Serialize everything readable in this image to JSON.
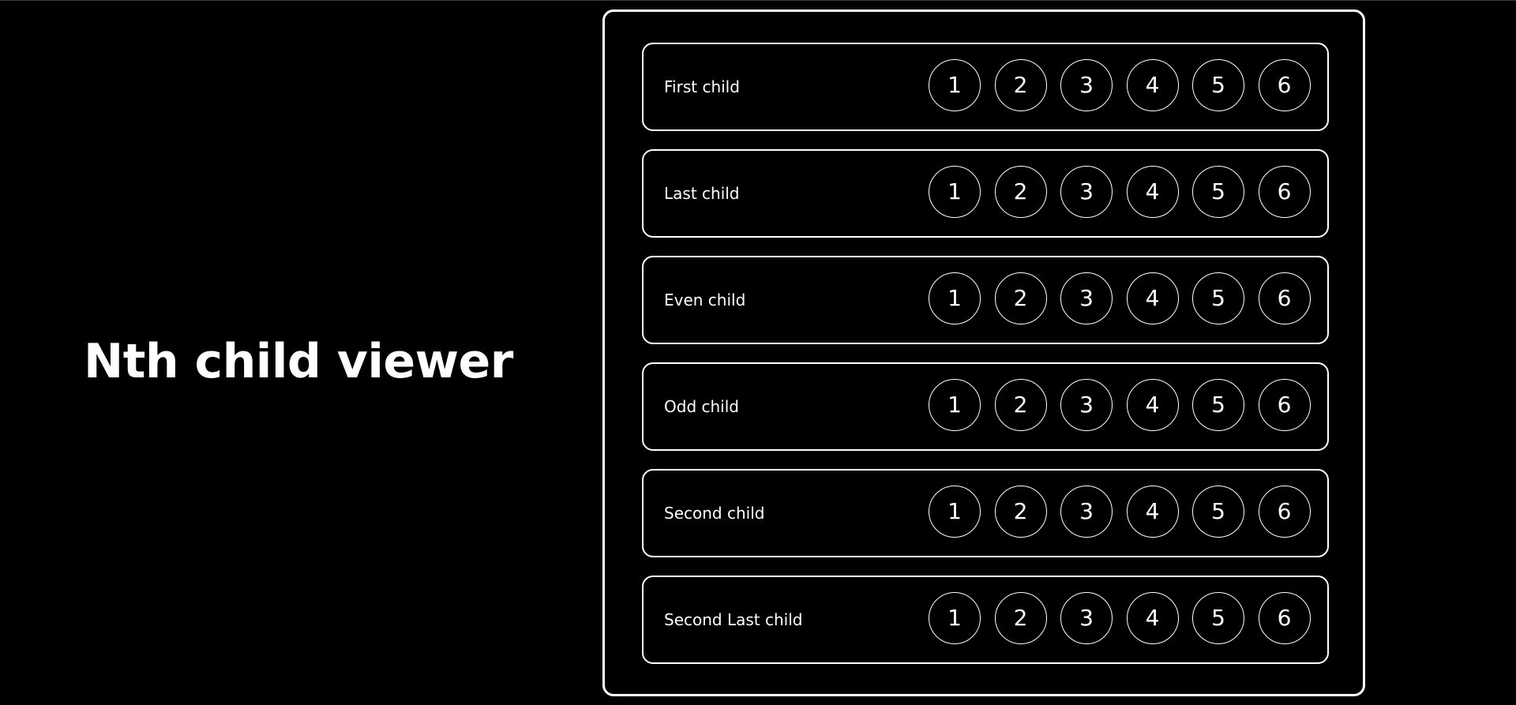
{
  "page": {
    "title": "Nth child viewer"
  },
  "colors": {
    "background": "#000000",
    "foreground": "#ffffff"
  },
  "rows": [
    {
      "label": "First child",
      "items": [
        "1",
        "2",
        "3",
        "4",
        "5",
        "6"
      ]
    },
    {
      "label": "Last child",
      "items": [
        "1",
        "2",
        "3",
        "4",
        "5",
        "6"
      ]
    },
    {
      "label": "Even child",
      "items": [
        "1",
        "2",
        "3",
        "4",
        "5",
        "6"
      ]
    },
    {
      "label": "Odd child",
      "items": [
        "1",
        "2",
        "3",
        "4",
        "5",
        "6"
      ]
    },
    {
      "label": "Second child",
      "items": [
        "1",
        "2",
        "3",
        "4",
        "5",
        "6"
      ]
    },
    {
      "label": "Second Last child",
      "items": [
        "1",
        "2",
        "3",
        "4",
        "5",
        "6"
      ]
    }
  ]
}
